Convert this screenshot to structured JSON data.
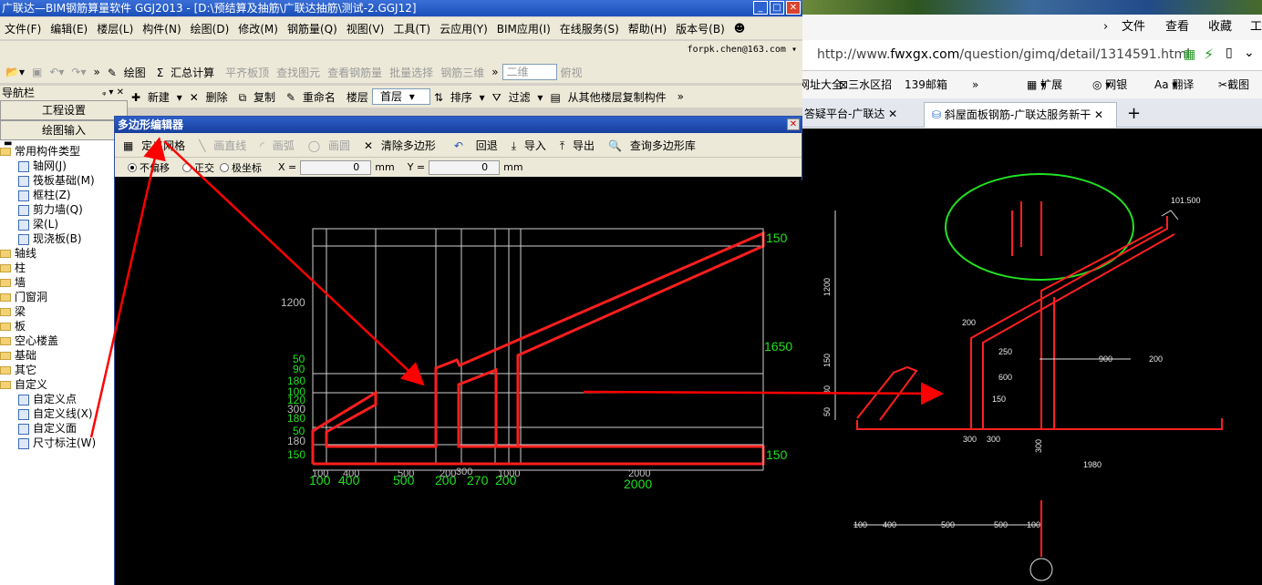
{
  "app": {
    "title": "广联达—BIM钢筋算量软件 GGJ2013 - [D:\\预结算及抽筋\\广联达抽筋\\测试-2.GGJ12]",
    "menu": [
      "文件(F)",
      "编辑(E)",
      "楼层(L)",
      "构件(N)",
      "绘图(D)",
      "修改(M)",
      "钢筋量(Q)",
      "视图(V)",
      "工具(T)",
      "云应用(Y)",
      "BIM应用(I)",
      "在线服务(S)",
      "帮助(H)",
      "版本号(B)"
    ],
    "user": "forpk.chen@163.com",
    "toolbar1": {
      "draw": "绘图",
      "summary": "汇总计算",
      "flush_slab": "平齐板顶",
      "find": "查找图元",
      "view_rebar": "查看钢筋量",
      "batch": "批量选择",
      "rebar3d": "钢筋三维",
      "view2d": "二维",
      "view_top": "俯视"
    },
    "toolbar2": {
      "new": "新建",
      "delete": "删除",
      "copy": "复制",
      "rename": "重命名",
      "floor_label": "楼层",
      "floor_value": "首层",
      "sort": "排序",
      "filter": "过滤",
      "copy_from": "从其他楼层复制构件"
    },
    "nav": {
      "title": "导航栏",
      "btn_project": "工程设置",
      "btn_draw": "绘图输入",
      "tree": [
        {
          "label": "常用构件类型",
          "level": 1,
          "kind": "folder"
        },
        {
          "label": "轴网(J)",
          "level": 2,
          "kind": "item"
        },
        {
          "label": "筏板基础(M)",
          "level": 2,
          "kind": "item"
        },
        {
          "label": "框柱(Z)",
          "level": 2,
          "kind": "item"
        },
        {
          "label": "剪力墙(Q)",
          "level": 2,
          "kind": "item"
        },
        {
          "label": "梁(L)",
          "level": 2,
          "kind": "item"
        },
        {
          "label": "现浇板(B)",
          "level": 2,
          "kind": "item"
        },
        {
          "label": "轴线",
          "level": 1,
          "kind": "folder"
        },
        {
          "label": "柱",
          "level": 1,
          "kind": "folder"
        },
        {
          "label": "墙",
          "level": 1,
          "kind": "folder"
        },
        {
          "label": "门窗洞",
          "level": 1,
          "kind": "folder"
        },
        {
          "label": "梁",
          "level": 1,
          "kind": "folder"
        },
        {
          "label": "板",
          "level": 1,
          "kind": "folder"
        },
        {
          "label": "空心楼盖",
          "level": 1,
          "kind": "folder"
        },
        {
          "label": "基础",
          "level": 1,
          "kind": "folder"
        },
        {
          "label": "其它",
          "level": 1,
          "kind": "folder"
        },
        {
          "label": "自定义",
          "level": 1,
          "kind": "folder"
        },
        {
          "label": "自定义点",
          "level": 2,
          "kind": "item"
        },
        {
          "label": "自定义线(X)",
          "level": 2,
          "kind": "item"
        },
        {
          "label": "自定义面",
          "level": 2,
          "kind": "item"
        },
        {
          "label": "尺寸标注(W)",
          "level": 2,
          "kind": "item"
        }
      ]
    }
  },
  "editor": {
    "title": "多边形编辑器",
    "toolbar": {
      "define_grid": "定义网格",
      "draw_line": "画直线",
      "draw_arc": "画弧",
      "draw_circle": "画圆",
      "clear": "清除多边形",
      "undo": "回退",
      "import": "导入",
      "export": "导出",
      "query_lib": "查询多边形库"
    },
    "snap": {
      "no_offset": "不偏移",
      "ortho": "正交",
      "polar": "极坐标",
      "x_label": "X =",
      "x_value": "0",
      "x_unit": "mm",
      "y_label": "Y =",
      "y_value": "0",
      "y_unit": "mm"
    },
    "grid": {
      "left_small": [
        "1200",
        "50",
        "90",
        "180",
        "100",
        "120",
        "180",
        "300",
        "50",
        "180",
        "150"
      ],
      "right_dims": [
        "150",
        "1650",
        "150"
      ],
      "bottom_dims": [
        "100",
        "400",
        "500",
        "200",
        "270",
        "200",
        "2000"
      ],
      "bottom_small": [
        "100",
        "400",
        "500",
        "200",
        "300",
        "1000",
        "2000"
      ]
    }
  },
  "browser": {
    "menu": [
      "文件",
      "查看",
      "收藏",
      "工具"
    ],
    "url_prefix": "http://www.",
    "url_domain": "fwxgx.com",
    "url_path": "/question/gimq/detail/1314591.html",
    "favorites": [
      "网址大全",
      "三水区招",
      "139邮箱",
      "扩展",
      "网银",
      "翻译",
      "截图"
    ],
    "tabs": [
      "答疑平台-广联达",
      "斜屋面板钢筋-广联达服务新干"
    ],
    "cad_labels": [
      "101.500",
      "1200",
      "150",
      "80",
      "50",
      "1980",
      "900",
      "200",
      "600",
      "150",
      "300",
      "300",
      "250",
      "200",
      "100",
      "400",
      "500",
      "500",
      "100",
      "300"
    ]
  },
  "colors": {
    "title_blue": "#1b4fb8",
    "toolbar_bg": "#ece9d8",
    "cad_red": "#ff2020",
    "cad_green": "#22e022",
    "annotation_red": "#ff0000"
  }
}
